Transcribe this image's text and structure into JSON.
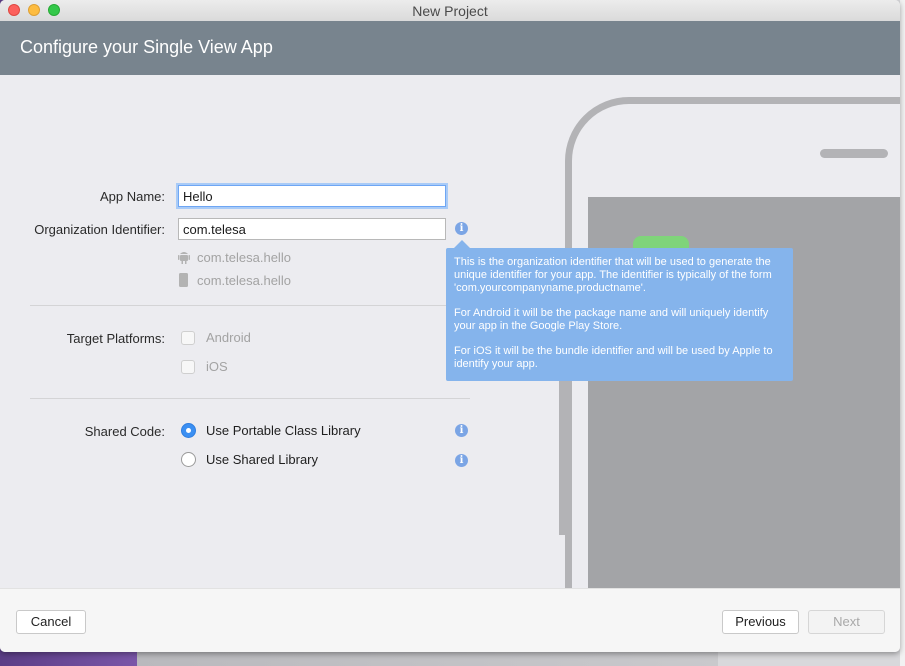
{
  "window": {
    "title": "New Project"
  },
  "header": {
    "title": "Configure your Single View App"
  },
  "form": {
    "app_name": {
      "label": "App Name:",
      "value": "Hello"
    },
    "org_id": {
      "label": "Organization Identifier:",
      "value": "com.telesa",
      "android_bundle": "com.telesa.hello",
      "ios_bundle": "com.telesa.hello"
    },
    "platforms": {
      "label": "Target Platforms:",
      "options": [
        {
          "label": "Android",
          "checked": false
        },
        {
          "label": "iOS",
          "checked": false
        }
      ]
    },
    "shared_code": {
      "label": "Shared Code:",
      "options": [
        {
          "label": "Use Portable Class Library",
          "selected": true
        },
        {
          "label": "Use Shared Library",
          "selected": false
        }
      ]
    }
  },
  "tooltip": {
    "para1": "This is the organization identifier that will be used to generate the unique identifier for your app. The identifier is typically of the form 'com.yourcompanyname.productname'.",
    "para2": "For Android it will be the package name and will uniquely identify your app in the Google Play Store.",
    "para3": "For iOS it will be the bundle identifier and will be used by Apple to identify your app."
  },
  "footer": {
    "cancel": "Cancel",
    "previous": "Previous",
    "next": "Next"
  },
  "icons": {
    "info": "i",
    "android": "android-icon",
    "phone": "phone-icon"
  },
  "colors": {
    "header_bg": "#78848e",
    "accent": "#3b8ff2",
    "tooltip_bg": "#85b4ec"
  }
}
